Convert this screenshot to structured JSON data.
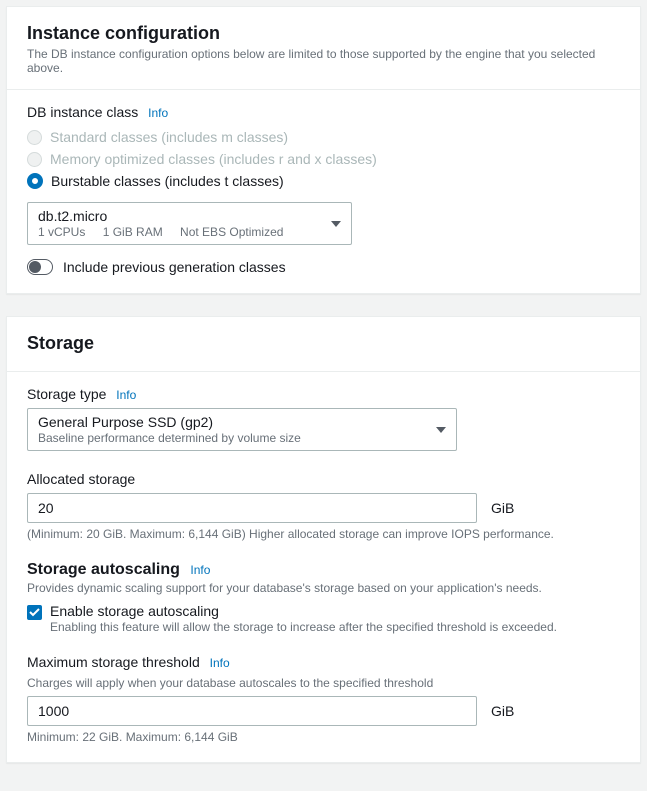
{
  "instance": {
    "title": "Instance configuration",
    "subtitle": "The DB instance configuration options below are limited to those supported by the engine that you selected above.",
    "class_label": "DB instance class",
    "info": "Info",
    "options": {
      "standard": "Standard classes (includes m classes)",
      "memory": "Memory optimized classes (includes r and x classes)",
      "burstable": "Burstable classes (includes t classes)"
    },
    "selected": {
      "name": "db.t2.micro",
      "vcpus": "1 vCPUs",
      "ram": "1 GiB RAM",
      "ebs": "Not EBS Optimized"
    },
    "include_prev": "Include previous generation classes"
  },
  "storage": {
    "title": "Storage",
    "type_label": "Storage type",
    "info": "Info",
    "type_selected": {
      "name": "General Purpose SSD (gp2)",
      "desc": "Baseline performance determined by volume size"
    },
    "allocated": {
      "label": "Allocated storage",
      "value": "20",
      "unit": "GiB",
      "hint": "(Minimum: 20 GiB. Maximum: 6,144 GiB) Higher allocated storage can improve IOPS performance."
    },
    "autoscaling": {
      "heading": "Storage autoscaling",
      "desc": "Provides dynamic scaling support for your database's storage based on your application's needs.",
      "enable_label": "Enable storage autoscaling",
      "enable_desc": "Enabling this feature will allow the storage to increase after the specified threshold is exceeded."
    },
    "threshold": {
      "label": "Maximum storage threshold",
      "desc": "Charges will apply when your database autoscales to the specified threshold",
      "value": "1000",
      "unit": "GiB",
      "hint": "Minimum: 22 GiB. Maximum: 6,144 GiB"
    }
  }
}
